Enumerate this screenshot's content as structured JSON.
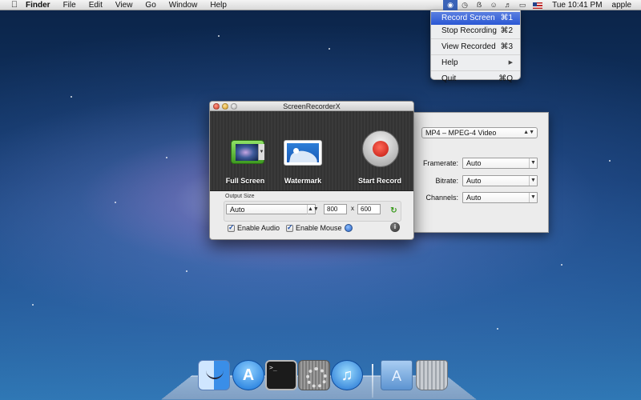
{
  "menubar": {
    "app_name": "Finder",
    "menus": [
      "File",
      "Edit",
      "View",
      "Go",
      "Window",
      "Help"
    ],
    "clock": "Tue 10:41 PM",
    "user": "apple",
    "status_icons": [
      "screenrecorder-icon",
      "time-machine-icon",
      "bluetooth-icon",
      "wifi-icon",
      "volume-icon",
      "battery-icon",
      "us-flag-icon"
    ]
  },
  "dropdown": {
    "items": [
      {
        "label": "Record Screen",
        "shortcut": "⌘1"
      },
      {
        "label": "Stop Recording",
        "shortcut": "⌘2"
      },
      {
        "label": "View Recorded",
        "shortcut": "⌘3"
      },
      {
        "label": "Help",
        "shortcut": ""
      },
      {
        "label": "Quit",
        "shortcut": "⌘Q"
      }
    ],
    "highlighted": "Record Screen"
  },
  "window": {
    "title": "ScreenRecorderX",
    "toolbar": {
      "full_screen": "Full Screen",
      "watermark": "Watermark",
      "start_record": "Start Record"
    },
    "output": {
      "group_title": "Output Size",
      "preset": "Auto",
      "width": "800",
      "times": "x",
      "height": "600"
    },
    "enable_audio": {
      "label": "Enable Audio",
      "checked": true
    },
    "enable_mouse": {
      "label": "Enable Mouse",
      "checked": true
    }
  },
  "panel": {
    "format": "MP4 – MPEG-4 Video",
    "framerate": {
      "label": "Framerate:",
      "value": "Auto"
    },
    "bitrate": {
      "label": "Bitrate:",
      "value": "Auto"
    },
    "channels": {
      "label": "Channels:",
      "value": "Auto"
    }
  },
  "dock": {
    "terminal_text": ">_",
    "items": [
      "finder-icon",
      "app-store-icon",
      "terminal-icon",
      "system-preferences-icon",
      "itunes-icon",
      "applications-folder-icon",
      "trash-icon"
    ]
  },
  "colors": {
    "menu_highlight": "#2a57d4",
    "record_red": "#c0150c",
    "green_icon": "#3f9a21"
  }
}
